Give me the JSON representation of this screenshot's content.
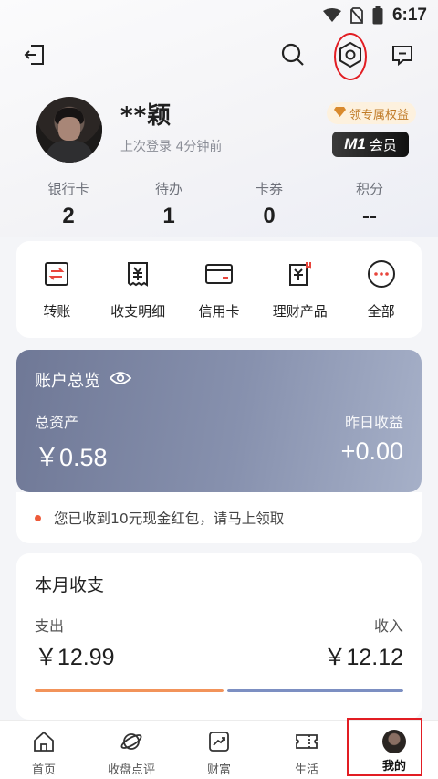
{
  "status_bar": {
    "time": "6:17"
  },
  "profile": {
    "name": "**颖",
    "last_login": "上次登录 4分钟前",
    "perk_label": "领专属权益",
    "member_tier": "M1",
    "member_label": "会员"
  },
  "stats": [
    {
      "label": "银行卡",
      "value": "2"
    },
    {
      "label": "待办",
      "value": "1"
    },
    {
      "label": "卡券",
      "value": "0"
    },
    {
      "label": "积分",
      "value": "--"
    }
  ],
  "quick_actions": [
    {
      "label": "转账",
      "icon": "transfer-icon"
    },
    {
      "label": "收支明细",
      "icon": "bill-icon"
    },
    {
      "label": "信用卡",
      "icon": "credit-card-icon"
    },
    {
      "label": "理财产品",
      "icon": "wealth-product-icon"
    },
    {
      "label": "全部",
      "icon": "more-icon"
    }
  ],
  "overview": {
    "title": "账户总览",
    "total_label": "总资产",
    "total_value": "￥0.58",
    "yesterday_label": "昨日收益",
    "yesterday_value": "+0.00"
  },
  "notice": {
    "text": "您已收到10元现金红包，请马上领取"
  },
  "monthly": {
    "title": "本月收支",
    "expense_label": "支出",
    "expense_value": "￥12.99",
    "income_label": "收入",
    "income_value": "￥12.12"
  },
  "bottom_nav": [
    {
      "label": "首页",
      "icon": "home-icon"
    },
    {
      "label": "收盘点评",
      "icon": "planet-icon"
    },
    {
      "label": "财富",
      "icon": "chart-trend-icon"
    },
    {
      "label": "生活",
      "icon": "ticket-icon"
    },
    {
      "label": "我的",
      "icon": "avatar"
    }
  ],
  "colors": {
    "accent_red": "#e21d23",
    "overview_gradient_start": "#6f7896",
    "overview_gradient_end": "#a6b0c8",
    "expense_bar": "#f2935a",
    "income_bar": "#7c8fc2"
  }
}
